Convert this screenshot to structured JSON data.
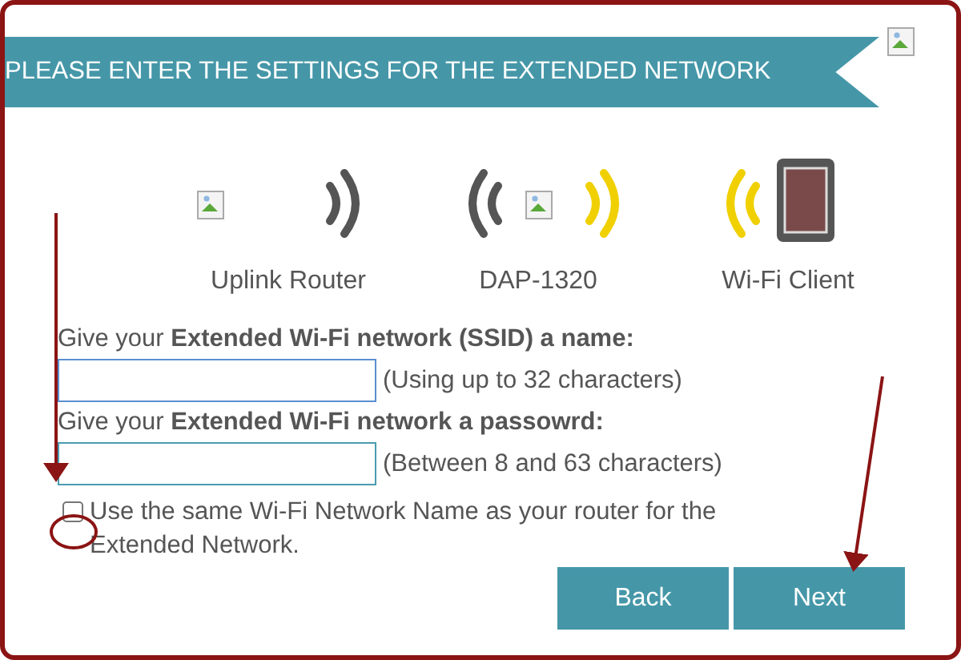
{
  "banner": {
    "title": "PLEASE ENTER THE SETTINGS FOR THE EXTENDED NETWORK"
  },
  "devices": [
    {
      "kind": "router",
      "label": "Uplink Router"
    },
    {
      "kind": "extender",
      "label": "DAP-1320"
    },
    {
      "kind": "client",
      "label": "Wi-Fi Client"
    }
  ],
  "fields": [
    {
      "label": "Give your **Extended Wi-Fi network (SSID) a name:**",
      "hint": "(Using up to 32 characters)"
    },
    {
      "label": "Give your **Extended Wi-Fi network a passowrd:**",
      "hint": "(Between 8 and 63 characters)"
    }
  ],
  "same_name_option": {
    "label": "Use the same Wi-Fi Network Name as your router for the Extended Network.",
    "checked": false
  },
  "buttons": [
    "Back",
    "Next"
  ]
}
